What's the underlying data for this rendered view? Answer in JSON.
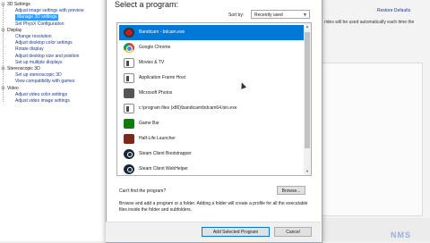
{
  "tree": {
    "items": [
      {
        "text": "3D Settings",
        "level": 0,
        "style": "head"
      },
      {
        "text": "Adjust image settings with preview",
        "level": 1,
        "style": "link"
      },
      {
        "text": "Manage 3D settings",
        "level": 1,
        "style": "sel"
      },
      {
        "text": "Set PhysX Configuration",
        "level": 1,
        "style": "link"
      },
      {
        "text": "Display",
        "level": 0,
        "style": "head"
      },
      {
        "text": "Change resolution",
        "level": 1,
        "style": "link"
      },
      {
        "text": "Adjust desktop color settings",
        "level": 1,
        "style": "link"
      },
      {
        "text": "Rotate display",
        "level": 1,
        "style": "link"
      },
      {
        "text": "Adjust desktop size and position",
        "level": 1,
        "style": "link"
      },
      {
        "text": "Set up multiple displays",
        "level": 1,
        "style": "link"
      },
      {
        "text": "Stereoscopic 3D",
        "level": 0,
        "style": "head"
      },
      {
        "text": "Set up stereoscopic 3D",
        "level": 1,
        "style": "link"
      },
      {
        "text": "View compatibility with games",
        "level": 1,
        "style": "link"
      },
      {
        "text": "Video",
        "level": 0,
        "style": "head"
      },
      {
        "text": "Adjust video color settings",
        "level": 1,
        "style": "link"
      },
      {
        "text": "Adjust video image settings",
        "level": 1,
        "style": "link"
      }
    ]
  },
  "background": {
    "restore_label": "Restore Defaults",
    "fragment": "rides will be used automatically each time the"
  },
  "dialog": {
    "title": "Select a program:",
    "sort_label": "Sort by:",
    "sort_value": "Recently used",
    "programs": [
      {
        "label": "Bandicam - bdcam.exe",
        "icon": "bandicam-icon",
        "selected": true
      },
      {
        "label": "Google Chrome",
        "icon": "chrome-icon",
        "selected": false
      },
      {
        "label": "Movies & TV",
        "icon": "generic-app-icon",
        "selected": false
      },
      {
        "label": "Application Frame Host",
        "icon": "generic-app-icon",
        "selected": false
      },
      {
        "label": "Microsoft Photos",
        "icon": "photos-icon",
        "selected": false
      },
      {
        "label": "c:\\program files (x86)\\bandicam\\bdcam64.bin.exe",
        "icon": "generic-app-icon",
        "selected": false
      },
      {
        "label": "Game Bar",
        "icon": "game-bar-icon",
        "selected": false
      },
      {
        "label": "Half-Life Launcher",
        "icon": "half-life-icon",
        "selected": false
      },
      {
        "label": "Steam Client Bootstrapper",
        "icon": "steam-icon",
        "selected": false
      },
      {
        "label": "Steam Client WebHelper",
        "icon": "steam-icon",
        "selected": false
      }
    ],
    "cant_find": "Can't find the program?",
    "browse_label": "Browse...",
    "description": "Browse and add a program or a folder. Adding a folder will create a profile for all the executable files inside the folder and subfolders.",
    "add_label": "Add Selected Program",
    "cancel_label": "Cancel"
  },
  "watermark": "NMS",
  "colors": {
    "selection": "#0078d7",
    "tree_selection": "#3399ff",
    "link": "#1f3a93"
  }
}
